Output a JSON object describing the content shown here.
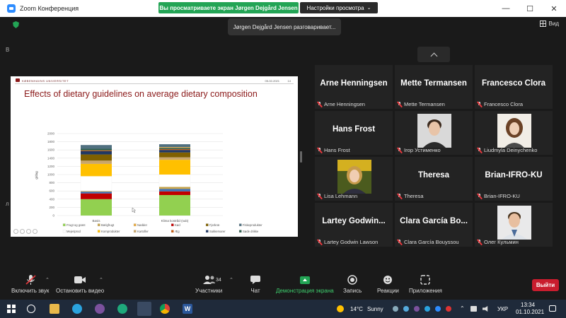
{
  "window": {
    "title": "Zoom Конференция",
    "share_banner": "Вы просматриваете экран Jørgen Dejgård Jensen",
    "view_options": "Настройки просмотра",
    "minimize": "—",
    "maximize": "☐",
    "close": "✕"
  },
  "meeting": {
    "speaking_toast": "Jørgen Dejgård Jensen разговаривает...",
    "view_label": "Вид",
    "edge_text_top": "В",
    "edge_text_bottom": "л"
  },
  "slide": {
    "university": "KØBENHAVNS UNIVERSITET",
    "date": "05-02-2021",
    "page": "14",
    "title": "Effects of dietary guidelines on average dietary composition"
  },
  "chart_data": {
    "type": "bar",
    "stacked": true,
    "title": "Effects of dietary guidelines on average dietary composition",
    "xlabel": "",
    "ylabel": "g/dag",
    "ylim": [
      0,
      2000
    ],
    "yticks": [
      "0",
      "200",
      "400",
      "600",
      "800",
      "1000",
      "1200",
      "1400",
      "1600",
      "1800",
      "2000"
    ],
    "grid": true,
    "legend_position": "bottom",
    "categories": [
      "Basis",
      "Klima kostråd (sub)"
    ],
    "series": [
      {
        "name": "Frugt og grønt",
        "color": "#92d050",
        "values": [
          400,
          500
        ]
      },
      {
        "name": "Kød",
        "color": "#c00000",
        "values": [
          140,
          90
        ]
      },
      {
        "name": "Fisk",
        "color": "#3b6fb6",
        "values": [
          40,
          60
        ]
      },
      {
        "name": "Bælgfrugt",
        "color": "#c6a34a",
        "values": [
          20,
          50
        ]
      },
      {
        "name": "Mejeriprod",
        "color": "#ffffff",
        "values": [
          360,
          300
        ]
      },
      {
        "name": "Kornprodukter",
        "color": "#ffc000",
        "values": [
          300,
          360
        ]
      },
      {
        "name": "Kartofler",
        "color": "#c9a66b",
        "values": [
          80,
          60
        ]
      },
      {
        "name": "Fjerkræ",
        "color": "#7f6000",
        "values": [
          150,
          120
        ]
      },
      {
        "name": "Sukkervarer",
        "color": "#203864",
        "values": [
          80,
          60
        ]
      },
      {
        "name": "Æg",
        "color": "#c55a11",
        "values": [
          20,
          20
        ]
      },
      {
        "name": "Søde drikke",
        "color": "#2e5e4e",
        "values": [
          40,
          30
        ]
      },
      {
        "name": "Nødder",
        "color": "#e5a840",
        "values": [
          0,
          20
        ]
      },
      {
        "name": "Fiskeprodukter",
        "color": "#507080",
        "values": [
          90,
          70
        ]
      }
    ],
    "legend": [
      "Frugt og grønt",
      "Bælgfrugt",
      "Nødder",
      "Kød",
      "Fjerkræ",
      "Fiskeprodukter",
      "Mejeriprod",
      "Kornprodukter",
      "Kartofler",
      "Æg",
      "Sukkervarer",
      "Søde drikke"
    ]
  },
  "participants": [
    {
      "name": "Arne Henningsen",
      "label": "Arne Henningsen",
      "video": false
    },
    {
      "name": "Mette Termansen",
      "label": "Mette Termansen",
      "video": false
    },
    {
      "name": "Francesco Clora",
      "label": "Francesco Clora",
      "video": false
    },
    {
      "name": "Hans Frost",
      "label": "Hans Frost",
      "video": false
    },
    {
      "name": "",
      "label": "Ігор Устименко",
      "video": true
    },
    {
      "name": "",
      "label": "Liudmyla Deinychenko",
      "video": true
    },
    {
      "name": "",
      "label": "Lisa Lehmann",
      "video": true
    },
    {
      "name": "Theresa",
      "label": "Theresa",
      "video": false
    },
    {
      "name": "Brian-IFRO-KU",
      "label": "Brian-IFRO-KU",
      "video": false
    },
    {
      "name": "Lartey Godwin...",
      "label": "Lartey Godwin Lawson",
      "video": false
    },
    {
      "name": "Clara García Bo...",
      "label": "Clara García Bouyssou",
      "video": false
    },
    {
      "name": "",
      "label": "Олег Кульмин",
      "video": true
    }
  ],
  "toolbar": {
    "unmute": "Включить звук",
    "start_video": "Остановить видео",
    "participants": "Участники",
    "participants_count": "34",
    "chat": "Чат",
    "share_screen": "Демонстрация экрана",
    "record": "Запись",
    "reactions": "Реакции",
    "apps": "Приложения",
    "leave": "Выйти"
  },
  "taskbar": {
    "weather_temp": "14°C",
    "weather_desc": "Sunny",
    "language": "УКР",
    "time": "13:34",
    "date": "01.10.2021",
    "word_icon_letter": "W"
  }
}
